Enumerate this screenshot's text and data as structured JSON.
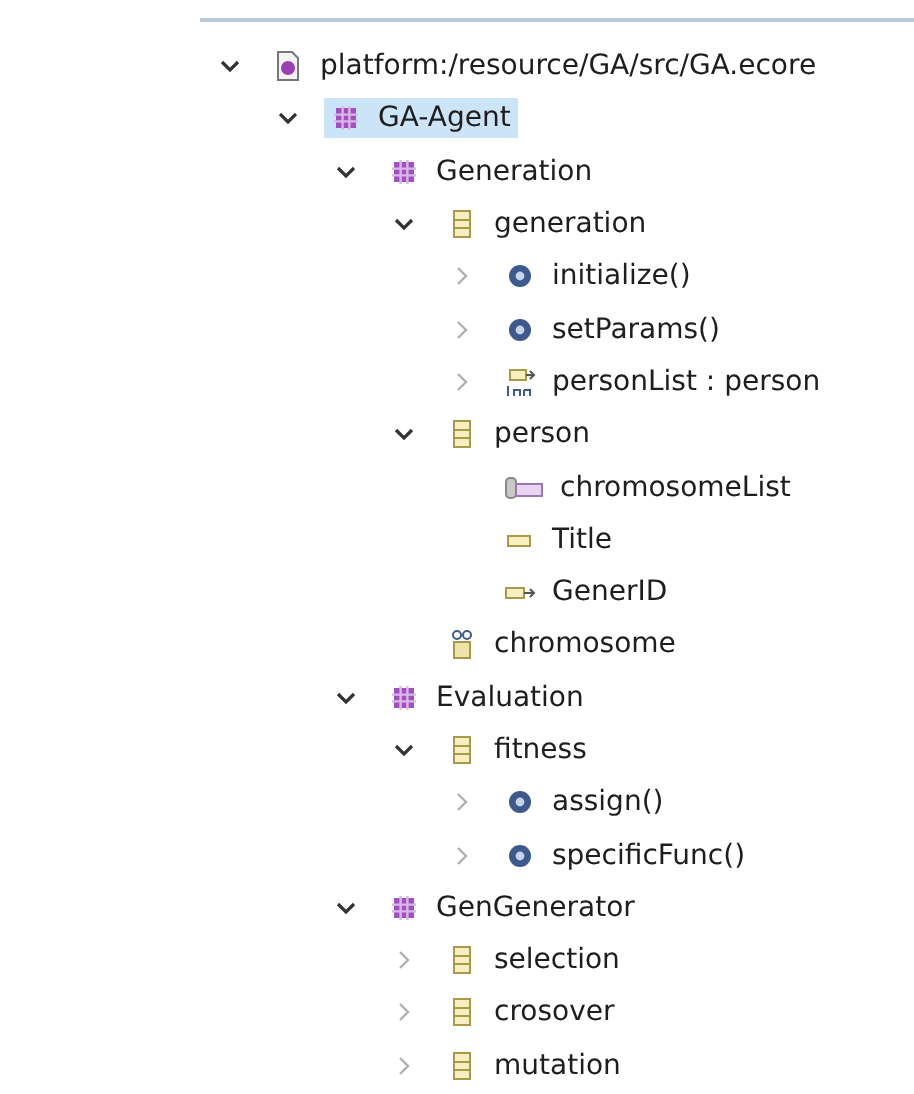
{
  "tree": [
    {
      "label": "platform:/resource/GA/src/GA.ecore",
      "kind": "resource",
      "expanded": true,
      "selected": false,
      "children": [
        {
          "label": "GA-Agent",
          "kind": "package",
          "expanded": true,
          "selected": true,
          "children": [
            {
              "label": "Generation",
              "kind": "package",
              "expanded": true,
              "selected": false,
              "children": [
                {
                  "label": "generation",
                  "kind": "class",
                  "expanded": true,
                  "selected": false,
                  "children": [
                    {
                      "label": "initialize()",
                      "kind": "operation",
                      "expanded": false,
                      "selected": false
                    },
                    {
                      "label": "setParams()",
                      "kind": "operation",
                      "expanded": false,
                      "selected": false
                    },
                    {
                      "label": "personList : person",
                      "kind": "reference",
                      "expanded": false,
                      "selected": false
                    }
                  ]
                },
                {
                  "label": "person",
                  "kind": "class",
                  "expanded": true,
                  "selected": false,
                  "children": [
                    {
                      "label": "chromosomeList",
                      "kind": "list-attribute",
                      "selected": false
                    },
                    {
                      "label": "Title",
                      "kind": "attribute",
                      "selected": false
                    },
                    {
                      "label": "GenerID",
                      "kind": "id-attribute",
                      "selected": false
                    }
                  ]
                },
                {
                  "label": "chromosome",
                  "kind": "datatype",
                  "selected": false
                }
              ]
            },
            {
              "label": "Evaluation",
              "kind": "package",
              "expanded": true,
              "selected": false,
              "children": [
                {
                  "label": "fitness",
                  "kind": "class",
                  "expanded": true,
                  "selected": false,
                  "children": [
                    {
                      "label": "assign()",
                      "kind": "operation",
                      "expanded": false,
                      "selected": false
                    },
                    {
                      "label": "specificFunc()",
                      "kind": "operation",
                      "expanded": false,
                      "selected": false
                    }
                  ]
                }
              ]
            },
            {
              "label": "GenGenerator",
              "kind": "package",
              "expanded": true,
              "selected": false,
              "children": [
                {
                  "label": "selection",
                  "kind": "class",
                  "expanded": false,
                  "selected": false
                },
                {
                  "label": "crosover",
                  "kind": "class",
                  "expanded": false,
                  "selected": false
                },
                {
                  "label": "mutation",
                  "kind": "class",
                  "expanded": false,
                  "selected": false
                }
              ]
            }
          ]
        }
      ]
    }
  ]
}
